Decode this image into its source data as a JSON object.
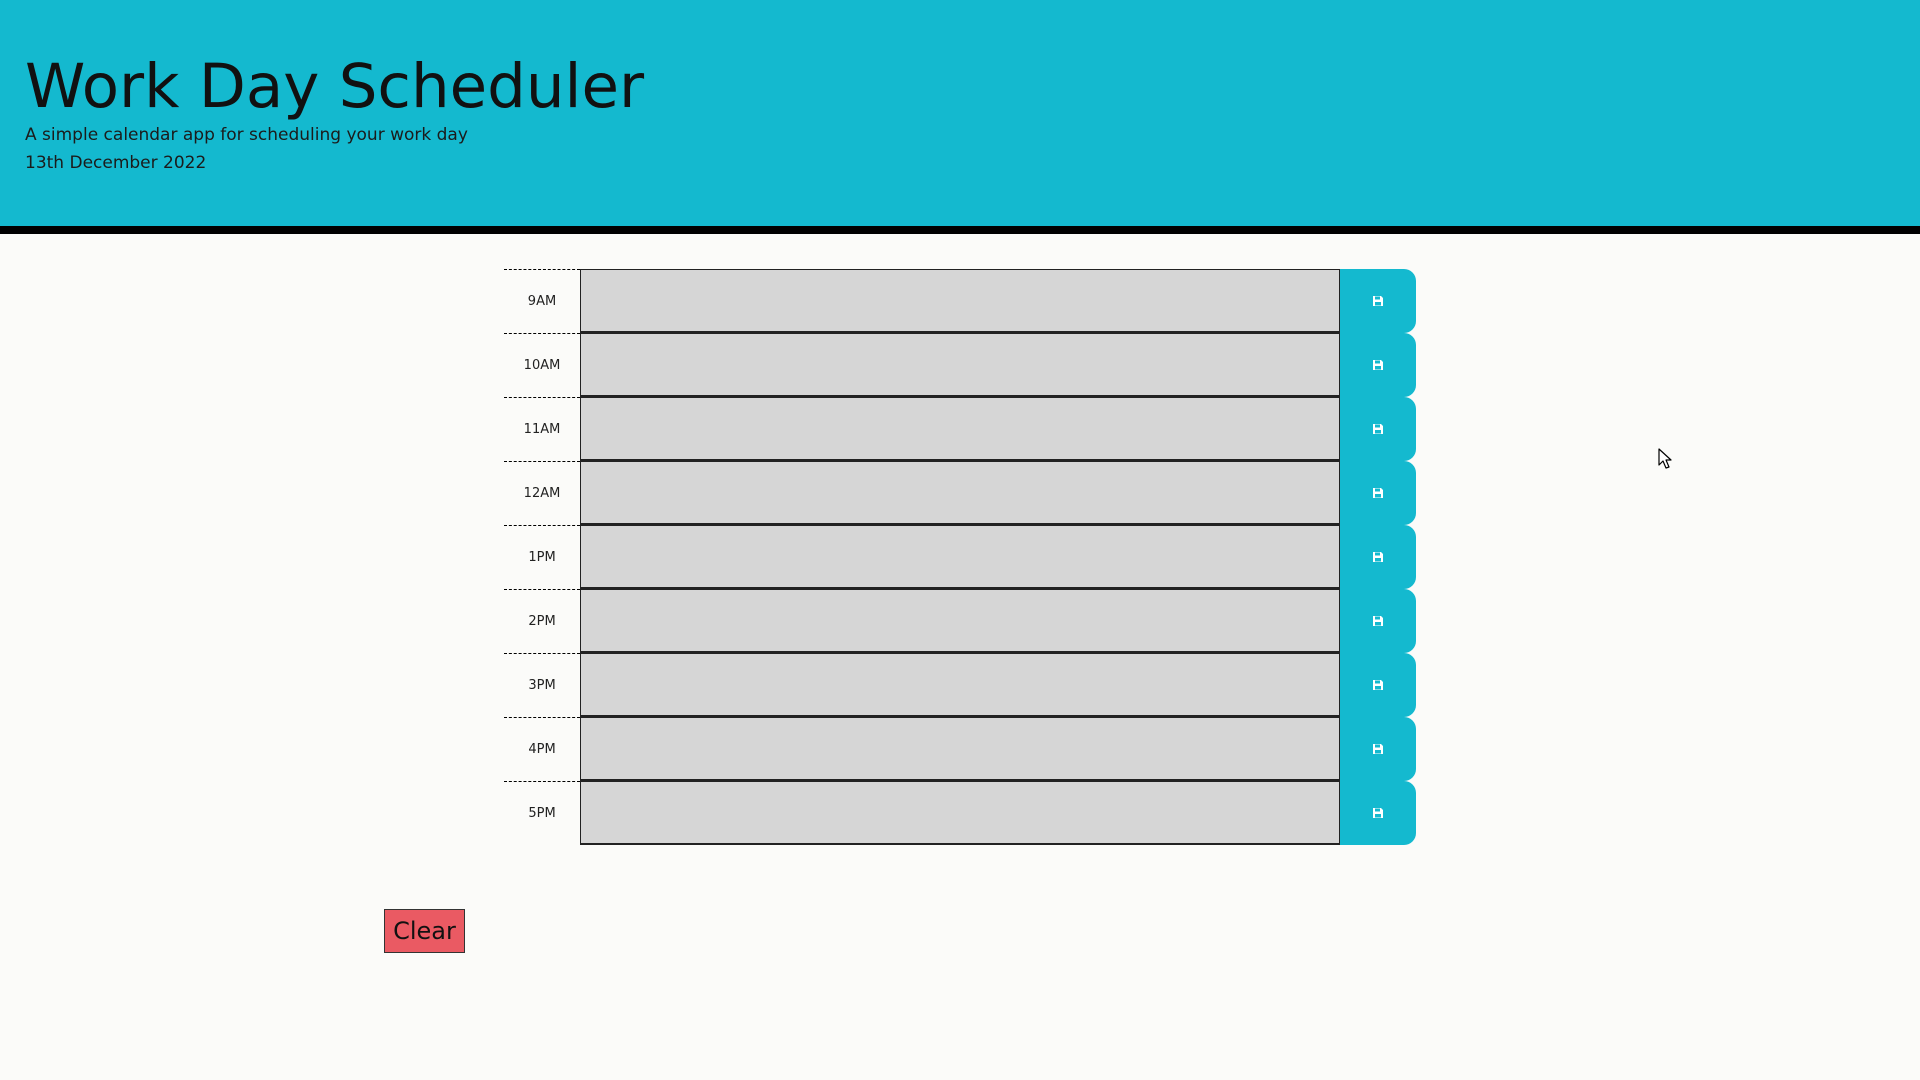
{
  "header": {
    "title": "Work Day Scheduler",
    "subtitle": "A simple calendar app for scheduling your work day",
    "date": "13th December 2022"
  },
  "schedule": {
    "rows": [
      {
        "hour": "9AM",
        "text": ""
      },
      {
        "hour": "10AM",
        "text": ""
      },
      {
        "hour": "11AM",
        "text": ""
      },
      {
        "hour": "12AM",
        "text": ""
      },
      {
        "hour": "1PM",
        "text": ""
      },
      {
        "hour": "2PM",
        "text": ""
      },
      {
        "hour": "3PM",
        "text": ""
      },
      {
        "hour": "4PM",
        "text": ""
      },
      {
        "hour": "5PM",
        "text": ""
      }
    ],
    "save_icon": "floppy-disk-icon"
  },
  "clear_button": {
    "label": "Clear"
  },
  "colors": {
    "header_bg": "#14b9cf",
    "save_button": "#14b9cf",
    "time_block_bg": "#d6d6d6",
    "clear_button": "#ea5a63",
    "page_bg": "#fbfbf9"
  }
}
